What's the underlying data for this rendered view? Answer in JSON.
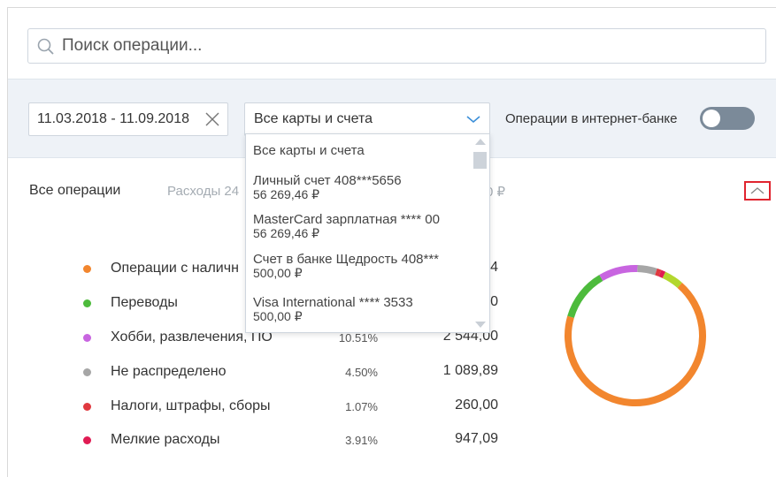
{
  "search": {
    "placeholder": "Поиск операции..."
  },
  "filters": {
    "date_range": "11.03.2018 - 11.09.2018",
    "account_select": "Все карты и счета",
    "internet_bank_label": "Операции в интернет-банке"
  },
  "tabs": {
    "all": "Все операции",
    "expenses": "Расходы 24",
    "income": "0 ₽"
  },
  "dropdown": {
    "items": [
      {
        "title": "Все карты и счета",
        "amount": ""
      },
      {
        "title": "Личный счет 408***5656",
        "amount": "56 269,46 ₽"
      },
      {
        "title": "MasterCard зарплатная **** 00",
        "amount": "56 269,46 ₽"
      },
      {
        "title": "Счет в банке Щедрость 408***",
        "amount": "500,00 ₽"
      },
      {
        "title": "Visa International **** 3533",
        "amount": "500,00 ₽"
      }
    ]
  },
  "categories": [
    {
      "name": "Операции с наличн",
      "pct": "",
      "amount": "4",
      "color": "#f2862e"
    },
    {
      "name": "Переводы",
      "pct": "",
      "amount": "0",
      "color": "#4dbb3c"
    },
    {
      "name": "Хобби, развлечения, ПО",
      "pct": "10.51%",
      "amount": "2 544,00",
      "color": "#c865e0"
    },
    {
      "name": "Не распределено",
      "pct": "4.50%",
      "amount": "1 089,89",
      "color": "#a6a6a6"
    },
    {
      "name": "Налоги, штрафы, сборы",
      "pct": "1.07%",
      "amount": "260,00",
      "color": "#e0393f"
    },
    {
      "name": "Мелкие расходы",
      "pct": "3.91%",
      "amount": "947,09",
      "color": "#e01b53"
    }
  ],
  "donut": {
    "segments": [
      {
        "fraction": 0.045,
        "color": "#b3d72e"
      },
      {
        "fraction": 0.68,
        "color": "#f2862e"
      },
      {
        "fraction": 0.12,
        "color": "#4dbb3c"
      },
      {
        "fraction": 0.09,
        "color": "#c865e0"
      },
      {
        "fraction": 0.045,
        "color": "#a6a6a6"
      },
      {
        "fraction": 0.01,
        "color": "#e0393f"
      },
      {
        "fraction": 0.01,
        "color": "#e01b53"
      }
    ]
  }
}
